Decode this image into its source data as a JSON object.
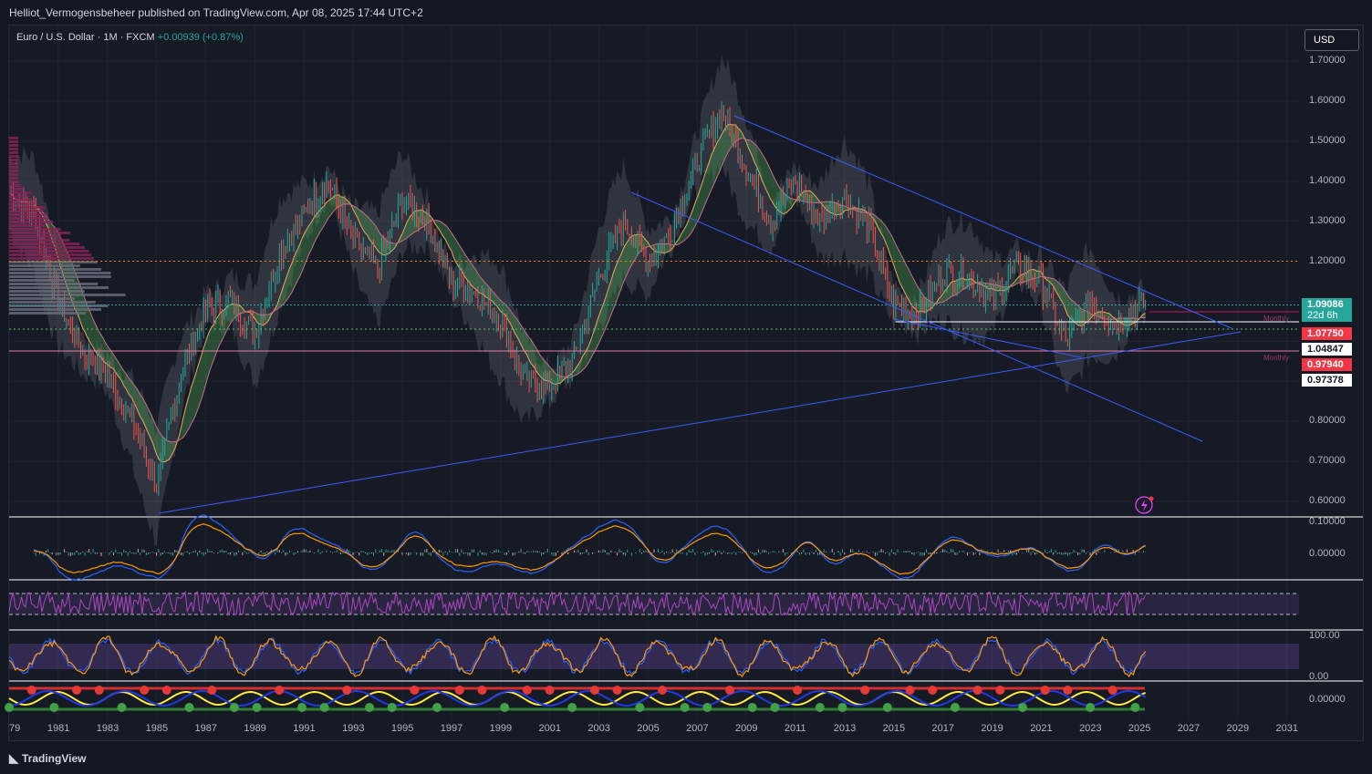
{
  "header": {
    "published": "Helliot_Vermogensbeheer published on TradingView.com, Apr 08, 2025 17:44 UTC+2"
  },
  "legend": {
    "symbol": "Euro / U.S. Dollar · 1M · FXCM",
    "change": "+0.00939 (+0.87%)"
  },
  "currency": "USD",
  "price_axis": [
    "1.70000",
    "1.60000",
    "1.50000",
    "1.40000",
    "1.30000",
    "1.20000",
    "0.80000",
    "0.70000",
    "0.60000"
  ],
  "price_tags": [
    {
      "value": "1.09086",
      "sub": "22d 6h",
      "bg": "#26a69a",
      "fg": "#ffffff"
    },
    {
      "value": "1.07750",
      "bg": "#f23645",
      "fg": "#ffffff"
    },
    {
      "value": "1.04847",
      "bg": "#ffffff",
      "fg": "#131722"
    },
    {
      "value": "0.97940",
      "bg": "#f23645",
      "fg": "#ffffff"
    },
    {
      "value": "0.97378",
      "bg": "#ffffff",
      "fg": "#131722"
    }
  ],
  "monthly_labels": [
    "Monthly",
    "Monthly"
  ],
  "panes": {
    "macd": [
      "0.10000",
      "0.00000"
    ],
    "stoch": [
      "100.00",
      "0.00"
    ],
    "bottom": [
      "0.00000"
    ]
  },
  "years": [
    "79",
    "1981",
    "1983",
    "1985",
    "1987",
    "1989",
    "1991",
    "1993",
    "1995",
    "1997",
    "1999",
    "2001",
    "2003",
    "2005",
    "2007",
    "2009",
    "2011",
    "2013",
    "2015",
    "2017",
    "2019",
    "2021",
    "2023",
    "2025",
    "2027",
    "2029",
    "2031"
  ],
  "footer": {
    "brand": "TradingView"
  },
  "chart_data": {
    "type": "candlestick",
    "title": "Euro / U.S. Dollar · 1M · FXCM",
    "x_range": [
      "1979",
      "2031"
    ],
    "ylim": [
      0.6,
      1.7
    ],
    "approx_close_path": [
      {
        "x": "1979",
        "y": 1.37
      },
      {
        "x": "1980",
        "y": 1.32
      },
      {
        "x": "1981",
        "y": 1.1
      },
      {
        "x": "1982",
        "y": 0.97
      },
      {
        "x": "1983",
        "y": 0.92
      },
      {
        "x": "1984",
        "y": 0.8
      },
      {
        "x": "1985",
        "y": 0.64
      },
      {
        "x": "1986",
        "y": 0.92
      },
      {
        "x": "1987",
        "y": 1.08
      },
      {
        "x": "1988",
        "y": 1.1
      },
      {
        "x": "1989",
        "y": 1.02
      },
      {
        "x": "1990",
        "y": 1.22
      },
      {
        "x": "1991",
        "y": 1.32
      },
      {
        "x": "1992",
        "y": 1.4
      },
      {
        "x": "1993",
        "y": 1.25
      },
      {
        "x": "1994",
        "y": 1.18
      },
      {
        "x": "1995",
        "y": 1.35
      },
      {
        "x": "1996",
        "y": 1.3
      },
      {
        "x": "1997",
        "y": 1.15
      },
      {
        "x": "1998",
        "y": 1.12
      },
      {
        "x": "1999",
        "y": 1.05
      },
      {
        "x": "2000",
        "y": 0.9
      },
      {
        "x": "2001",
        "y": 0.89
      },
      {
        "x": "2002",
        "y": 0.96
      },
      {
        "x": "2003",
        "y": 1.16
      },
      {
        "x": "2004",
        "y": 1.3
      },
      {
        "x": "2005",
        "y": 1.2
      },
      {
        "x": "2006",
        "y": 1.28
      },
      {
        "x": "2007",
        "y": 1.45
      },
      {
        "x": "2008",
        "y": 1.58
      },
      {
        "x": "2009",
        "y": 1.43
      },
      {
        "x": "2010",
        "y": 1.3
      },
      {
        "x": "2011",
        "y": 1.4
      },
      {
        "x": "2012",
        "y": 1.3
      },
      {
        "x": "2013",
        "y": 1.36
      },
      {
        "x": "2014",
        "y": 1.28
      },
      {
        "x": "2015",
        "y": 1.09
      },
      {
        "x": "2016",
        "y": 1.07
      },
      {
        "x": "2017",
        "y": 1.17
      },
      {
        "x": "2018",
        "y": 1.16
      },
      {
        "x": "2019",
        "y": 1.11
      },
      {
        "x": "2020",
        "y": 1.19
      },
      {
        "x": "2021",
        "y": 1.15
      },
      {
        "x": "2022",
        "y": 1.0
      },
      {
        "x": "2023",
        "y": 1.1
      },
      {
        "x": "2024",
        "y": 1.04
      },
      {
        "x": "2025",
        "y": 1.09
      }
    ],
    "horizontal_levels": [
      1.2,
      1.09086,
      1.0775,
      1.04847,
      0.9794
    ],
    "last_price": 1.09086
  }
}
